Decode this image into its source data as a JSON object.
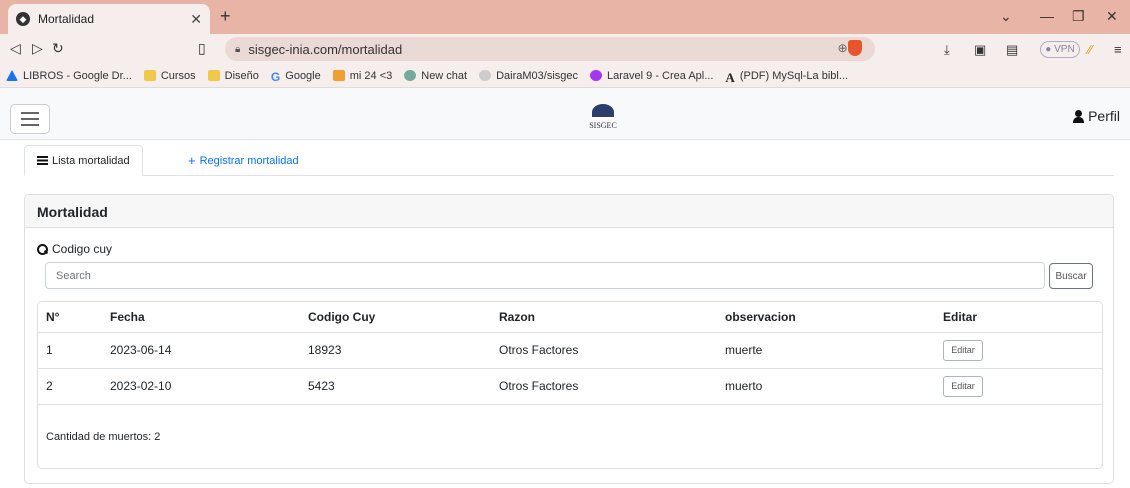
{
  "browser": {
    "tab_title": "Mortalidad",
    "new_tab": "+",
    "url": "sisgec-inia.com/mortalidad",
    "vpn": "VPN",
    "bookmarks": [
      {
        "label": "LIBROS - Google Dr...",
        "icon": "drive-icon",
        "color": "#1a73e8"
      },
      {
        "label": "Cursos",
        "icon": "folder-icon",
        "color": "#f2c84b"
      },
      {
        "label": "Diseño",
        "icon": "folder-icon",
        "color": "#f2c84b"
      },
      {
        "label": "Google",
        "icon": "google-icon",
        "color": "#4285f4"
      },
      {
        "label": "mi 24 <3",
        "icon": "video-icon",
        "color": "#f0a030"
      },
      {
        "label": "New chat",
        "icon": "chatgpt-icon",
        "color": "#74aa9c"
      },
      {
        "label": "DairaM03/sisgec",
        "icon": "github-icon",
        "color": "#cccccc"
      },
      {
        "label": "Laravel 9 - Crea Apl...",
        "icon": "udemy-icon",
        "color": "#a435f0"
      },
      {
        "label": "(PDF) MySql-La bibl...",
        "icon": "academia-icon",
        "color": "#222222"
      }
    ]
  },
  "app": {
    "logo_text": "SISGEC",
    "profile": "Perfil",
    "tabs": {
      "list": "Lista mortalidad",
      "register": "Registrar mortalidad"
    },
    "card_title": "Mortalidad",
    "search_label": "Codigo cuy",
    "search_placeholder": "Search",
    "search_button": "Buscar",
    "table": {
      "headers": [
        "N°",
        "Fecha",
        "Codigo Cuy",
        "Razon",
        "observacion",
        "Editar"
      ],
      "rows": [
        {
          "n": "1",
          "fecha": "2023-06-14",
          "codigo": "18923",
          "razon": "Otros Factores",
          "observacion": "muerte",
          "accion": "Editar"
        },
        {
          "n": "2",
          "fecha": "2023-02-10",
          "codigo": "5423",
          "razon": "Otros Factores",
          "observacion": "muerto",
          "accion": "Editar"
        }
      ]
    },
    "total": "Cantidad de muertos: 2"
  }
}
